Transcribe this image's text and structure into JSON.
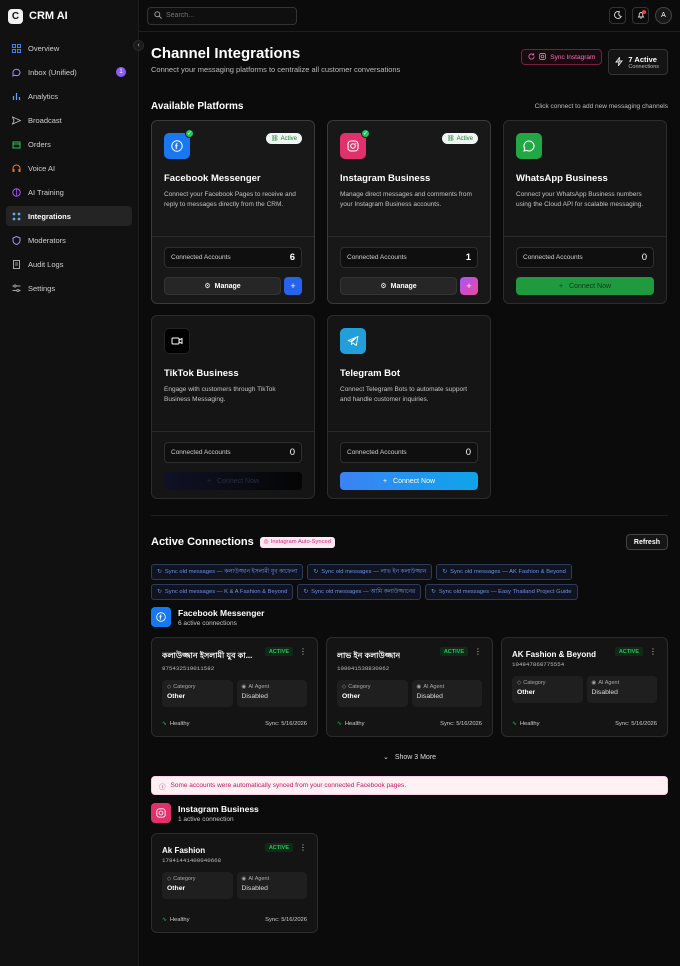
{
  "app": {
    "logo_letter": "C",
    "name": "CRM AI"
  },
  "sidebar": {
    "items": [
      {
        "label": "Overview",
        "icon": "grid-icon"
      },
      {
        "label": "Inbox (Unified)",
        "icon": "chat-bubble-icon",
        "badge": "1"
      },
      {
        "label": "Analytics",
        "icon": "bar-chart-icon"
      },
      {
        "label": "Broadcast",
        "icon": "send-icon"
      },
      {
        "label": "Orders",
        "icon": "package-icon"
      },
      {
        "label": "Voice AI",
        "icon": "headset-icon"
      },
      {
        "label": "AI Training",
        "icon": "brain-icon"
      },
      {
        "label": "Integrations",
        "icon": "plug-icon",
        "active": true
      },
      {
        "label": "Moderators",
        "icon": "shield-icon"
      },
      {
        "label": "Audit Logs",
        "icon": "file-list-icon"
      },
      {
        "label": "Settings",
        "icon": "sliders-icon"
      }
    ]
  },
  "topbar": {
    "search_placeholder": "Search...",
    "avatar": "A"
  },
  "page": {
    "title": "Channel Integrations",
    "subtitle": "Connect your messaging platforms to centralize all customer conversations",
    "sync_label": "Sync Instagram",
    "stat_count": "7 Active",
    "stat_label": "Connections"
  },
  "platforms_section": {
    "title": "Available Platforms",
    "hint": "Click connect to add new messaging channels"
  },
  "platforms": [
    {
      "name": "Facebook Messenger",
      "desc": "Connect your Facebook Pages to receive and reply to messages directly from the CRM.",
      "accounts_label": "Connected Accounts",
      "count": "6",
      "active_label": "Active",
      "manage_label": "Manage",
      "color": "#1877f2"
    },
    {
      "name": "Instagram Business",
      "desc": "Manage direct messages and comments from your Instagram Business accounts.",
      "accounts_label": "Connected Accounts",
      "count": "1",
      "active_label": "Active",
      "manage_label": "Manage",
      "color": "#e1306c"
    },
    {
      "name": "WhatsApp Business",
      "desc": "Connect your WhatsApp Business numbers using the Cloud API for scalable messaging.",
      "accounts_label": "Connected Accounts",
      "count": "0",
      "connect_label": "Connect Now",
      "color": "#22a745"
    },
    {
      "name": "TikTok Business",
      "desc": "Engage with customers through TikTok Business Messaging.",
      "accounts_label": "Connected Accounts",
      "count": "0",
      "connect_label": "Connect Now",
      "color": "#000000"
    },
    {
      "name": "Telegram Bot",
      "desc": "Connect Telegram Bots to automate support and handle customer inquiries.",
      "accounts_label": "Connected Accounts",
      "count": "0",
      "connect_label": "Connect Now",
      "color": "#229ed9"
    }
  ],
  "active_connections": {
    "title": "Active Connections",
    "auto_synced": "Instagram Auto-Synced",
    "refresh": "Refresh",
    "chips": [
      "Sync old messages — কলাউজ্জান ইসলামী যুব কাফেলা",
      "Sync old messages — লাভ ইন কলাউজ্জান",
      "Sync old messages — AK Fashion & Beyond",
      "Sync old messages — K & A Fashion & Beyond",
      "Sync old messages — আমি কলাউজ্জানের",
      "Sync old messages — Easy Thailand Project Guide"
    ],
    "facebook": {
      "title": "Facebook Messenger",
      "sub": "6 active connections",
      "cards": [
        {
          "name": "কলাউজ্জান ইসলামী যুব কা...",
          "id": "875432519011582",
          "status": "ACTIVE",
          "cat_label": "Category",
          "cat": "Other",
          "ai_label": "AI Agent",
          "ai": "Disabled",
          "health": "Healthy",
          "sync": "Sync: 5/16/2026"
        },
        {
          "name": "লাভ ইন কলাউজ্জান",
          "id": "100041538830062",
          "status": "ACTIVE",
          "cat_label": "Category",
          "cat": "Other",
          "ai_label": "AI Agent",
          "ai": "Disabled",
          "health": "Healthy",
          "sync": "Sync: 5/16/2026"
        },
        {
          "name": "AK Fashion & Beyond",
          "id": "104947868775554",
          "status": "ACTIVE",
          "cat_label": "Category",
          "cat": "Other",
          "ai_label": "AI Agent",
          "ai": "Disabled",
          "health": "Healthy",
          "sync": "Sync: 5/16/2026"
        }
      ],
      "show_more": "Show 3 More"
    },
    "notice": "Some accounts were automatically synced from your connected Facebook pages.",
    "instagram": {
      "title": "Instagram Business",
      "sub": "1 active connection",
      "cards": [
        {
          "name": "Ak Fashion",
          "id": "17841441400040668",
          "status": "ACTIVE",
          "cat_label": "Category",
          "cat": "Other",
          "ai_label": "AI Agent",
          "ai": "Disabled",
          "health": "Healthy",
          "sync": "Sync: 5/16/2026"
        }
      ]
    }
  }
}
